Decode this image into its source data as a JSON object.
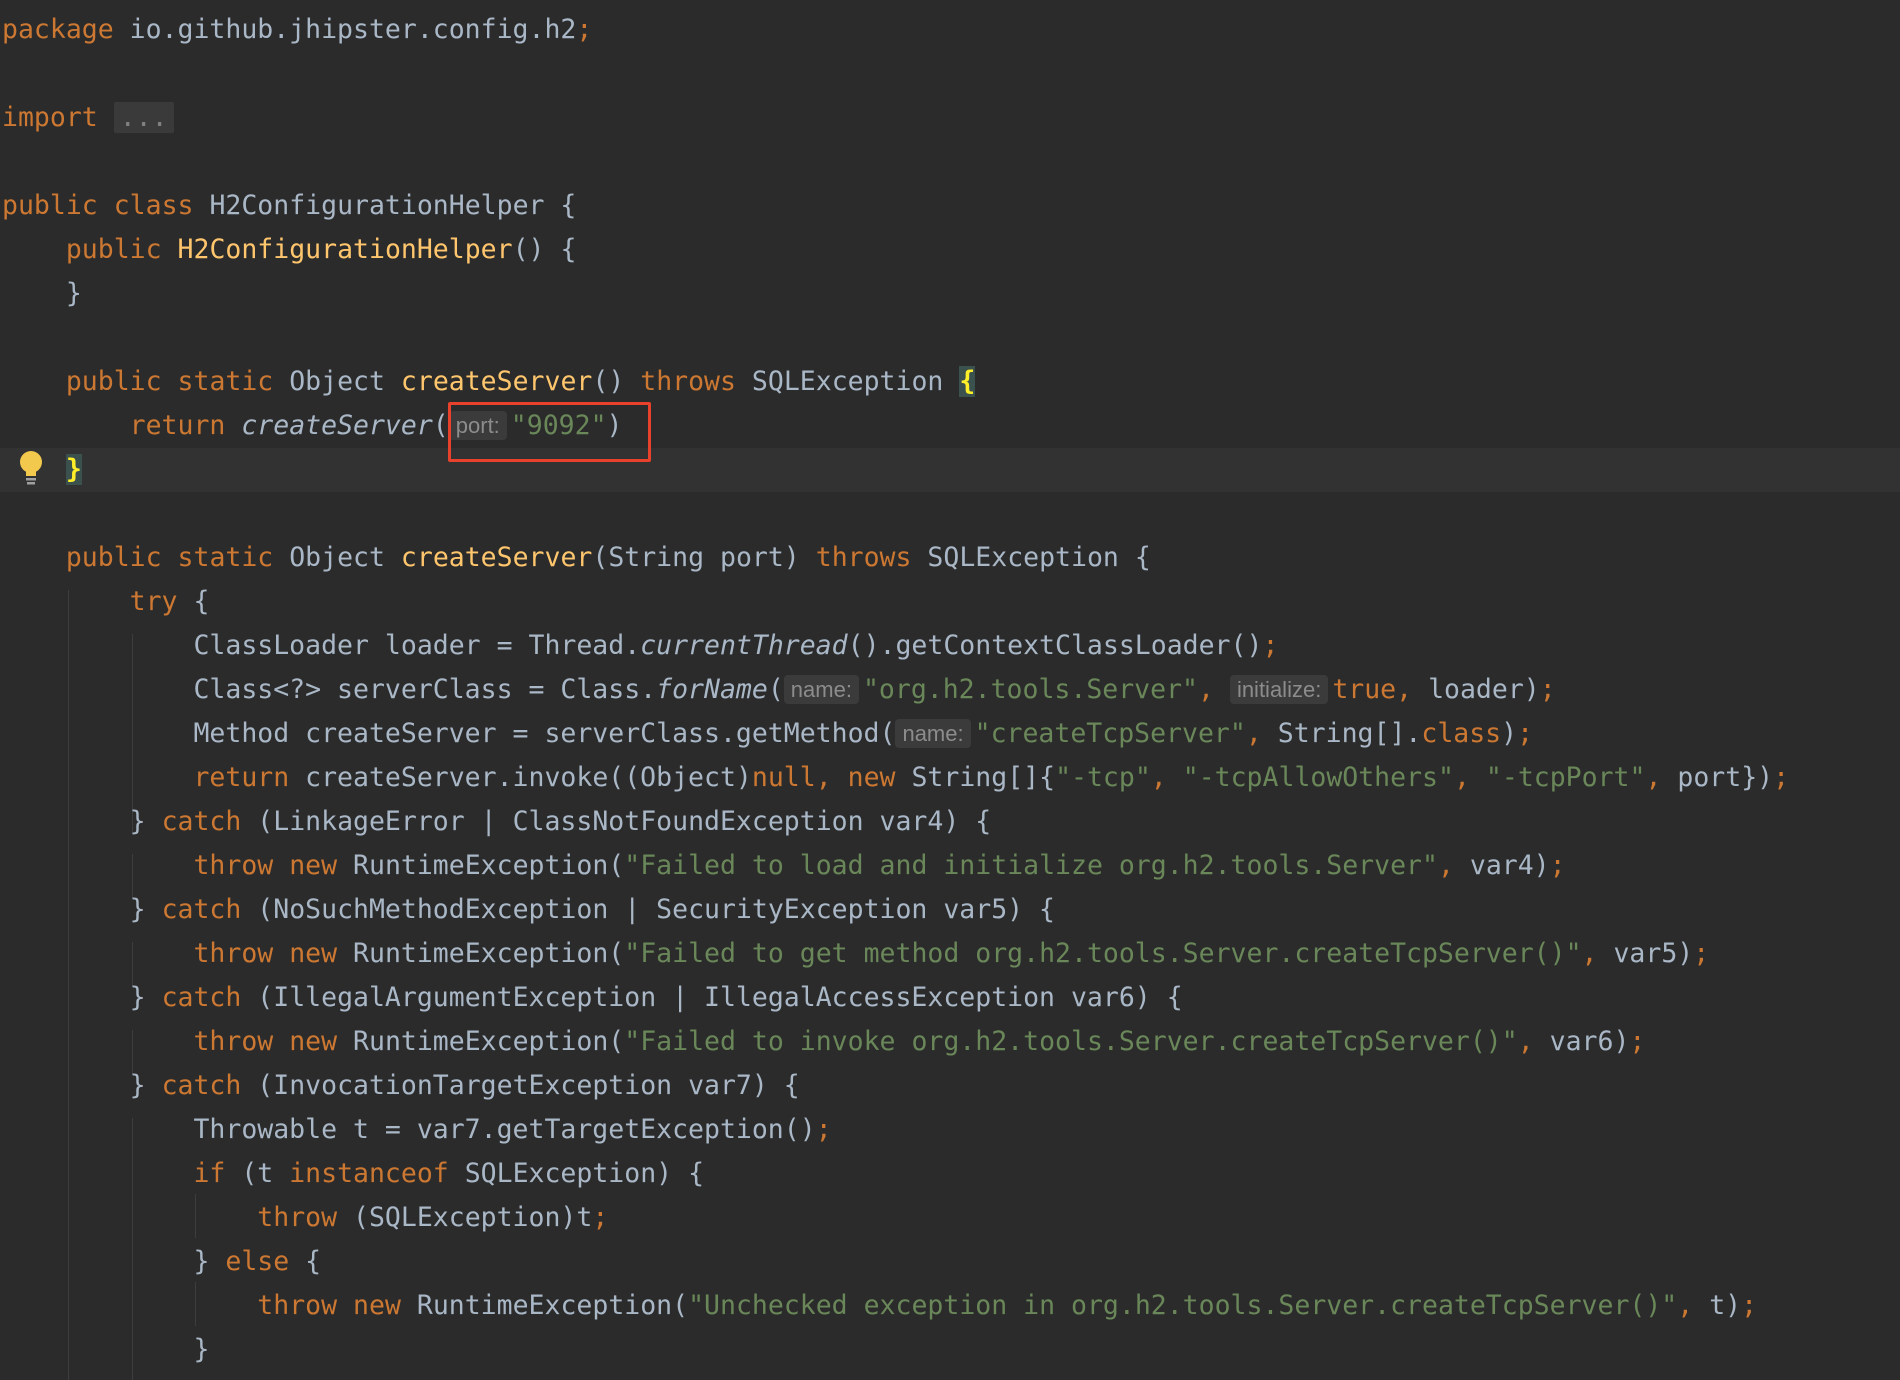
{
  "code": {
    "package_kw": "package",
    "package_name": " io.github.jhipster.config.h2",
    "import_kw": "import",
    "import_fold": "...",
    "class_public": "public",
    "class_kw": "class",
    "class_name": " H2ConfigurationHelper {",
    "ctor_public": "public",
    "ctor_name": "H2ConfigurationHelper",
    "ctor_rest": "() {",
    "ctor_close": "}",
    "m1_public": "public",
    "m1_static": "static",
    "m1_type": " Object ",
    "m1_name": "createServer",
    "m1_parens": "() ",
    "m1_throws": "throws",
    "m1_exc": " SQLException ",
    "m1_brace": "{",
    "m1_return": "return",
    "m1_call": "createServer",
    "m1_hint": "port:",
    "m1_arg": "\"9092\"",
    "m1_close_paren": ")",
    "m1_close": "}",
    "m2_public": "public",
    "m2_static": "static",
    "m2_type": " Object ",
    "m2_name": "createServer",
    "m2_params": "(String port) ",
    "m2_throws": "throws",
    "m2_exc": " SQLException {",
    "try_kw": "try",
    "try_brace": " {",
    "l_loader_a": "ClassLoader loader = Thread.",
    "l_loader_b": "currentThread",
    "l_loader_c": "().getContextClassLoader()",
    "l_cls_a": "Class<?> serverClass = Class.",
    "l_cls_b": "forName",
    "l_cls_hint1": "name:",
    "l_cls_str": "\"org.h2.tools.Server\"",
    "l_cls_hint2": "initialize:",
    "l_cls_true": "true",
    "l_cls_rest": " loader)",
    "l_meth_a": "Method createServer = serverClass.getMethod(",
    "l_meth_hint": "name:",
    "l_meth_str": "\"createTcpServer\"",
    "l_meth_b": " String[].",
    "l_meth_class": "class",
    "l_meth_c": ")",
    "l_ret_kw": "return",
    "l_ret_a": " createServer.invoke((Object)",
    "l_ret_null": "null",
    "l_ret_new": "new",
    "l_ret_b": " String[]{",
    "l_ret_s1": "\"-tcp\"",
    "l_ret_s2": "\"-tcpAllowOthers\"",
    "l_ret_s3": "\"-tcpPort\"",
    "l_ret_c": " port})",
    "c1_kw": "catch",
    "c1_rest": " (LinkageError | ClassNotFoundException var4) {",
    "t1_str": "\"Failed to load and initialize org.h2.tools.Server\"",
    "t1_var": " var4)",
    "c2_kw": "catch",
    "c2_rest": " (NoSuchMethodException | SecurityException var5) {",
    "t2_str": "\"Failed to get method org.h2.tools.Server.createTcpServer()\"",
    "t2_var": " var5)",
    "c3_kw": "catch",
    "c3_rest": " (IllegalArgumentException | IllegalAccessException var6) {",
    "t3_str": "\"Failed to invoke org.h2.tools.Server.createTcpServer()\"",
    "t3_var": " var6)",
    "c4_kw": "catch",
    "c4_rest": " (InvocationTargetException var7) {",
    "l_thr": "Throwable t = var7.getTargetException()",
    "if_kw": "if",
    "if_a": " (t ",
    "if_inst": "instanceof",
    "if_b": " SQLException) {",
    "throw_kw": "throw",
    "throw_rest": " (SQLException)t",
    "else_a": "} ",
    "else_kw": "else",
    "else_b": " {",
    "t4_str": "\"Unchecked exception in org.h2.tools.Server.createTcpServer()\"",
    "t4_var": " t)",
    "closing": "}",
    "throw": "throw",
    "new": "new",
    "runtime_exc": " RuntimeException(",
    "semi": ";",
    "comma": ",",
    "close_brace_prefix": "} "
  },
  "colors": {
    "keyword": "#cc7832",
    "function": "#ffc66d",
    "string": "#6a8759",
    "text": "#a9b7c6",
    "highlight_box": "#e8412c"
  },
  "icons": [
    "lightbulb-icon"
  ]
}
